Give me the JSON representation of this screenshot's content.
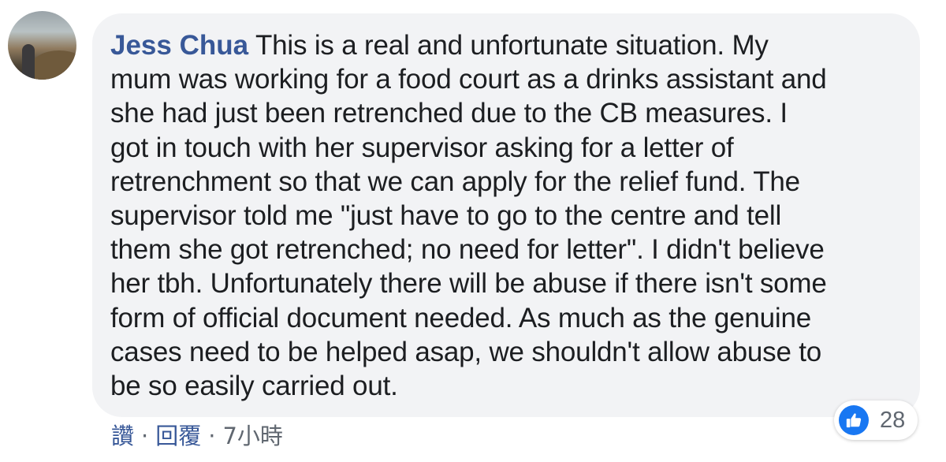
{
  "comment": {
    "author": "Jess Chua",
    "lines": [
      " This is a real and unfortunate situation. My",
      "mum was working for a food court as a drinks assistant and",
      "she had just been retrenched due to the CB measures. I",
      "got in touch with her supervisor asking for a letter of",
      "retrenchment so that we can apply for the relief fund. The",
      "supervisor told me \"just have to go to the centre and tell",
      "them she got retrenched; no need for letter\". I didn't believe",
      "her tbh. Unfortunately there will be abuse if there isn't some",
      "form of official document needed. As much as the genuine",
      "cases need to be helped asap, we shouldn't allow abuse to",
      "be so easily carried out."
    ]
  },
  "reactions": {
    "icon": "like-thumb-icon",
    "count": "28",
    "color": "#1877f2"
  },
  "actions": {
    "like": "讚",
    "reply": "回覆",
    "separator": "·",
    "time": "7小時"
  }
}
